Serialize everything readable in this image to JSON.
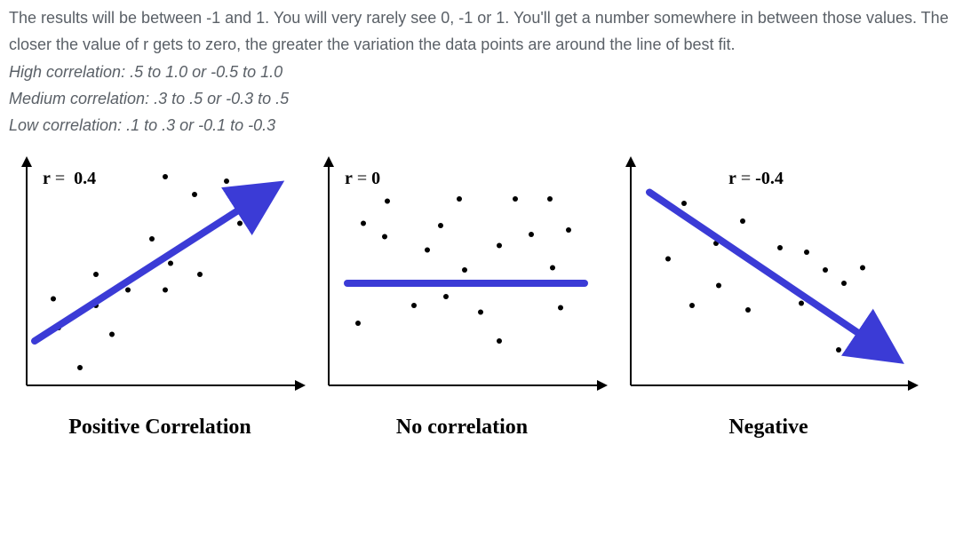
{
  "intro": "The results will be between -1 and 1. You will very rarely see 0, -1 or 1. You'll get a number somewhere in between those values. The closer the value of r gets to zero, the greater the variation the data points are around the line of best fit.",
  "rules": {
    "high": {
      "label": "High correlation",
      "range": ": .5 to 1.0 or -0.5 to 1.0"
    },
    "medium": {
      "label": "Medium correlation",
      "range": ": .3 to .5 or -0.3 to .5"
    },
    "low": {
      "label": "Low correlation",
      "range": ": .1 to .3 or -0.1 to -0.3"
    }
  },
  "glyphs": {
    "r": "r",
    "eq": " = "
  },
  "chart_data": [
    {
      "type": "scatter",
      "title": "Positive Correlation",
      "r_value": "0.4",
      "axes": {
        "xmin": 0,
        "xmax": 10,
        "ymin": 0,
        "ymax": 10
      },
      "trend": {
        "x1": 0.3,
        "y1": 2.0,
        "x2": 9.0,
        "y2": 8.7,
        "arrow": true
      },
      "points": [
        [
          1.0,
          3.9
        ],
        [
          1.2,
          2.6
        ],
        [
          2.0,
          0.8
        ],
        [
          2.6,
          3.6
        ],
        [
          2.6,
          5.0
        ],
        [
          3.2,
          2.3
        ],
        [
          3.8,
          4.3
        ],
        [
          4.7,
          6.6
        ],
        [
          5.2,
          9.4
        ],
        [
          5.2,
          4.3
        ],
        [
          5.4,
          5.5
        ],
        [
          6.3,
          8.6
        ],
        [
          6.5,
          5.0
        ],
        [
          7.5,
          9.2
        ],
        [
          8.0,
          7.3
        ]
      ]
    },
    {
      "type": "scatter",
      "title": "No correlation",
      "r_value": "0",
      "axes": {
        "xmin": 0,
        "xmax": 10,
        "ymin": 0,
        "ymax": 10
      },
      "trend": {
        "x1": 0.7,
        "y1": 4.6,
        "x2": 9.6,
        "y2": 4.6,
        "arrow": false
      },
      "points": [
        [
          1.1,
          2.8
        ],
        [
          1.3,
          7.3
        ],
        [
          2.1,
          6.7
        ],
        [
          2.2,
          8.3
        ],
        [
          3.2,
          3.6
        ],
        [
          3.7,
          6.1
        ],
        [
          4.2,
          7.2
        ],
        [
          4.4,
          4.0
        ],
        [
          4.9,
          8.4
        ],
        [
          5.1,
          5.2
        ],
        [
          5.7,
          3.3
        ],
        [
          6.4,
          2.0
        ],
        [
          6.4,
          6.3
        ],
        [
          7.0,
          8.4
        ],
        [
          7.6,
          6.8
        ],
        [
          8.3,
          8.4
        ],
        [
          8.4,
          5.3
        ],
        [
          8.7,
          3.5
        ],
        [
          9.0,
          7.0
        ]
      ]
    },
    {
      "type": "scatter",
      "title": "Negative",
      "r_value": "-0.4",
      "axes": {
        "xmin": 0,
        "xmax": 10,
        "ymin": 0,
        "ymax": 10
      },
      "trend": {
        "x1": 0.7,
        "y1": 8.7,
        "x2": 9.6,
        "y2": 1.5,
        "arrow": true
      },
      "points": [
        [
          1.4,
          5.7
        ],
        [
          2.0,
          8.2
        ],
        [
          2.3,
          3.6
        ],
        [
          3.2,
          6.4
        ],
        [
          3.3,
          4.5
        ],
        [
          4.2,
          7.4
        ],
        [
          4.4,
          3.4
        ],
        [
          5.6,
          6.2
        ],
        [
          6.4,
          3.7
        ],
        [
          6.6,
          6.0
        ],
        [
          7.3,
          5.2
        ],
        [
          7.8,
          1.6
        ],
        [
          8.0,
          4.6
        ],
        [
          8.7,
          5.3
        ],
        [
          9.0,
          1.8
        ]
      ]
    }
  ]
}
